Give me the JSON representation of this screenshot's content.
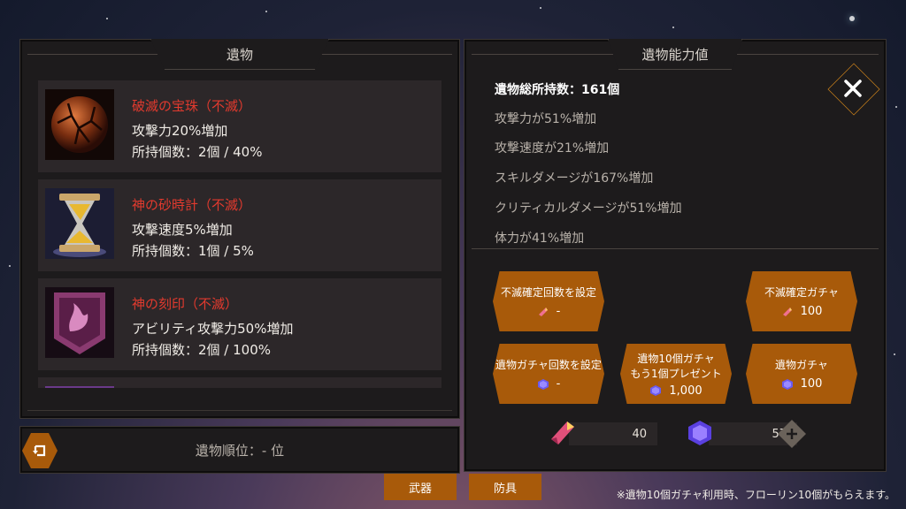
{
  "left_panel": {
    "title": "遺物",
    "relics": [
      {
        "name": "破滅の宝珠（不滅）",
        "effect": "攻撃力20%増加",
        "count": "所持個数：2個 / 40%",
        "icon": "cracked-orb-icon"
      },
      {
        "name": "神の砂時計（不滅）",
        "effect": "攻撃速度5%増加",
        "count": "所持個数：1個 / 5%",
        "icon": "hourglass-icon"
      },
      {
        "name": "神の刻印（不滅）",
        "effect": "アビリティ攻撃力50%増加",
        "count": "所持個数：2個 / 100%",
        "icon": "sigil-icon"
      }
    ]
  },
  "rank_bar": {
    "label": "遺物順位：- 位"
  },
  "right_panel": {
    "title": "遺物能力値",
    "total_label": "遺物総所持数：161個",
    "stats": [
      "攻撃力が51%増加",
      "攻撃速度が21%増加",
      "スキルダメージが167%増加",
      "クリティカルダメージが51%増加",
      "体力が41%増加"
    ],
    "buttons": {
      "set_fixed_count": {
        "label": "不滅確定回数を設定",
        "cost": "-"
      },
      "fixed_gacha": {
        "label": "不滅確定ガチャ",
        "cost": "100"
      },
      "set_gacha_count": {
        "label": "遺物ガチャ回数を設定",
        "cost": "-"
      },
      "ten_gacha": {
        "label1": "遺物10個ガチャ",
        "label2": "もう1個プレゼント",
        "cost": "1,000"
      },
      "gacha": {
        "label": "遺物ガチャ",
        "cost": "100"
      }
    },
    "currency": {
      "crystal": "40",
      "gem": "57"
    }
  },
  "bottom_tabs": {
    "weapon": "武器",
    "armor": "防具"
  },
  "footnote": "※遺物10個ガチャ利用時、フローリン10個がもらえます。",
  "colors": {
    "accent_orange": "#a85a0a",
    "relic_name_red": "#e23a2e"
  }
}
